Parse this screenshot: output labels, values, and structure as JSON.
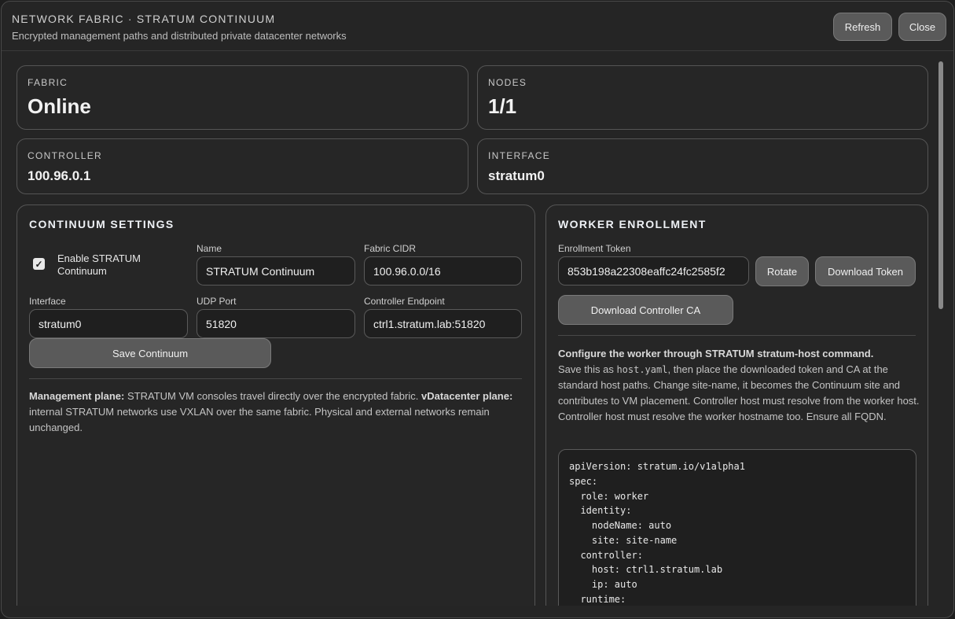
{
  "header": {
    "title": "NETWORK FABRIC · STRATUM CONTINUUM",
    "subtitle": "Encrypted management paths and distributed private datacenter networks",
    "refresh_label": "Refresh",
    "close_label": "Close"
  },
  "stats": {
    "fabric_label": "FABRIC",
    "fabric_value": "Online",
    "nodes_label": "NODES",
    "nodes_value": "1/1",
    "controller_label": "CONTROLLER",
    "controller_value": "100.96.0.1",
    "interface_label": "INTERFACE",
    "interface_value": "stratum0"
  },
  "settings": {
    "title": "CONTINUUM SETTINGS",
    "enable_label_1": "Enable STRATUM",
    "enable_label_2": "Continuum",
    "enable_checked": true,
    "name_label": "Name",
    "name_value": "STRATUM Continuum",
    "cidr_label": "Fabric CIDR",
    "cidr_value": "100.96.0.0/16",
    "interface_label": "Interface",
    "interface_value": "stratum0",
    "udp_label": "UDP Port",
    "udp_value": "51820",
    "endpoint_label": "Controller Endpoint",
    "endpoint_value": "ctrl1.stratum.lab:51820",
    "save_label": "Save Continuum",
    "desc_mgmt_bold": "Management plane:",
    "desc_mgmt_text": " STRATUM VM consoles travel directly over the encrypted fabric. ",
    "desc_vdc_bold": "vDatacenter plane:",
    "desc_vdc_text": " internal STRATUM networks use VXLAN over the same fabric. Physical and external networks remain unchanged."
  },
  "enrollment": {
    "title": "WORKER ENROLLMENT",
    "token_label": "Enrollment Token",
    "token_value": "853b198a22308eaffc24fc2585f2",
    "rotate_label": "Rotate",
    "download_token_label": "Download Token",
    "download_ca_label": "Download Controller CA",
    "instructions_bold": "Configure the worker through STRATUM stratum-host command.",
    "instructions_pre": "Save this as ",
    "instructions_file": "host.yaml",
    "instructions_post": ", then place the downloaded token and CA at the standard host paths. Change site-name, it becomes the Continuum site and contributes to VM placement. Controller host must resolve from the worker host. Controller host must resolve the worker hostname too. Ensure all FQDN.",
    "yaml_lines": [
      "apiVersion: stratum.io/v1alpha1",
      "spec:",
      "  role: worker",
      "  identity:",
      "    nodeName: auto",
      "    site: site-name",
      "  controller:",
      "    host: ctrl1.stratum.lab",
      "    ip: auto",
      "  runtime:"
    ]
  }
}
